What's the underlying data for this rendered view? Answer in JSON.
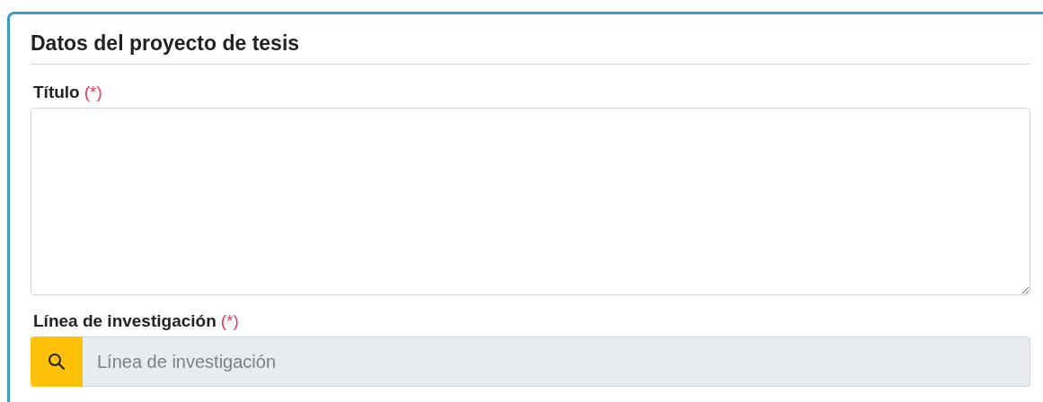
{
  "card": {
    "title": "Datos del proyecto de tesis"
  },
  "fields": [
    {
      "kind": "textarea",
      "label": "Título",
      "required_mark": "(*)"
    },
    {
      "kind": "lookup",
      "label": "Línea de investigación",
      "required_mark": "(*)",
      "placeholder": "Línea de investigación",
      "disabled": true
    }
  ]
}
